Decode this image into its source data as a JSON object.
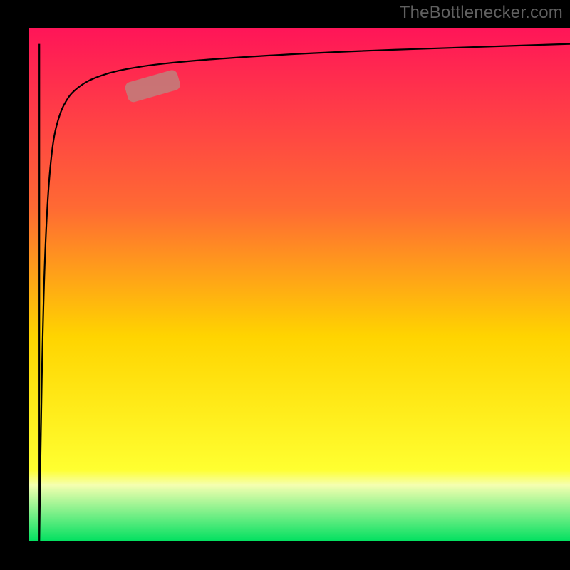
{
  "watermark": {
    "text": "TheBottlenecker.com"
  },
  "colors": {
    "gradient_top": "#ff1558",
    "gradient_mid1": "#ff6a33",
    "gradient_mid2": "#ffd400",
    "gradient_mid3": "#ffff30",
    "gradient_bottom": "#00e060",
    "curve": "#000000",
    "marker": "#c47a78",
    "frame": "#000000"
  },
  "chart_data": {
    "type": "line",
    "title": "",
    "xlabel": "",
    "ylabel": "",
    "xlim": [
      0,
      100
    ],
    "ylim": [
      0,
      100
    ],
    "series": [
      {
        "name": "curve",
        "x": [
          2.0,
          2.1,
          2.3,
          2.6,
          3.0,
          3.5,
          4.0,
          4.5,
          5.0,
          6.0,
          7.0,
          8.0,
          10.0,
          12.0,
          15.0,
          18.0,
          22.0,
          28.0,
          35.0,
          45.0,
          60.0,
          80.0,
          100.0
        ],
        "y": [
          0.0,
          8.0,
          22.0,
          40.0,
          55.0,
          66.0,
          73.0,
          77.5,
          80.5,
          84.0,
          86.0,
          87.5,
          89.2,
          90.3,
          91.4,
          92.1,
          92.8,
          93.5,
          94.1,
          94.8,
          95.6,
          96.3,
          97.0
        ]
      }
    ],
    "marker": {
      "x_range": [
        18.0,
        28.0
      ],
      "y_range": [
        86.5,
        90.5
      ]
    }
  }
}
